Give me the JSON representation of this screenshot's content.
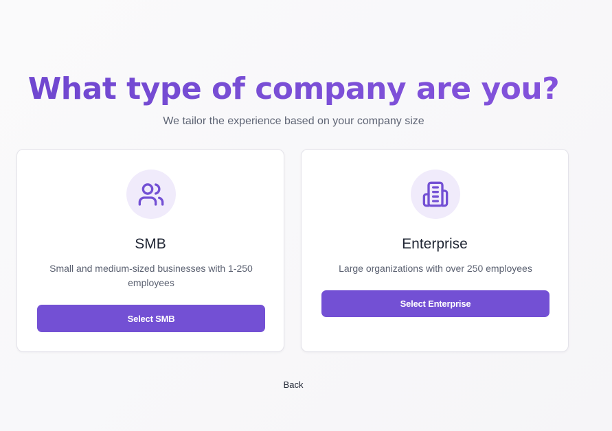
{
  "header": {
    "title": "What type of company are you?",
    "subtitle": "We tailor the experience based on your company size"
  },
  "options": [
    {
      "icon": "users-icon",
      "title": "SMB",
      "description": "Small and medium-sized businesses with 1-250 employees",
      "button_label": "Select SMB"
    },
    {
      "icon": "building-icon",
      "title": "Enterprise",
      "description": "Large organizations with over 250 employees",
      "button_label": "Select Enterprise"
    }
  ],
  "footer": {
    "back_label": "Back"
  },
  "colors": {
    "accent": "#7350d4",
    "icon_bg": "#f0ebfb",
    "title_gradient_start": "#6f46cf",
    "title_gradient_end": "#8452dc"
  }
}
